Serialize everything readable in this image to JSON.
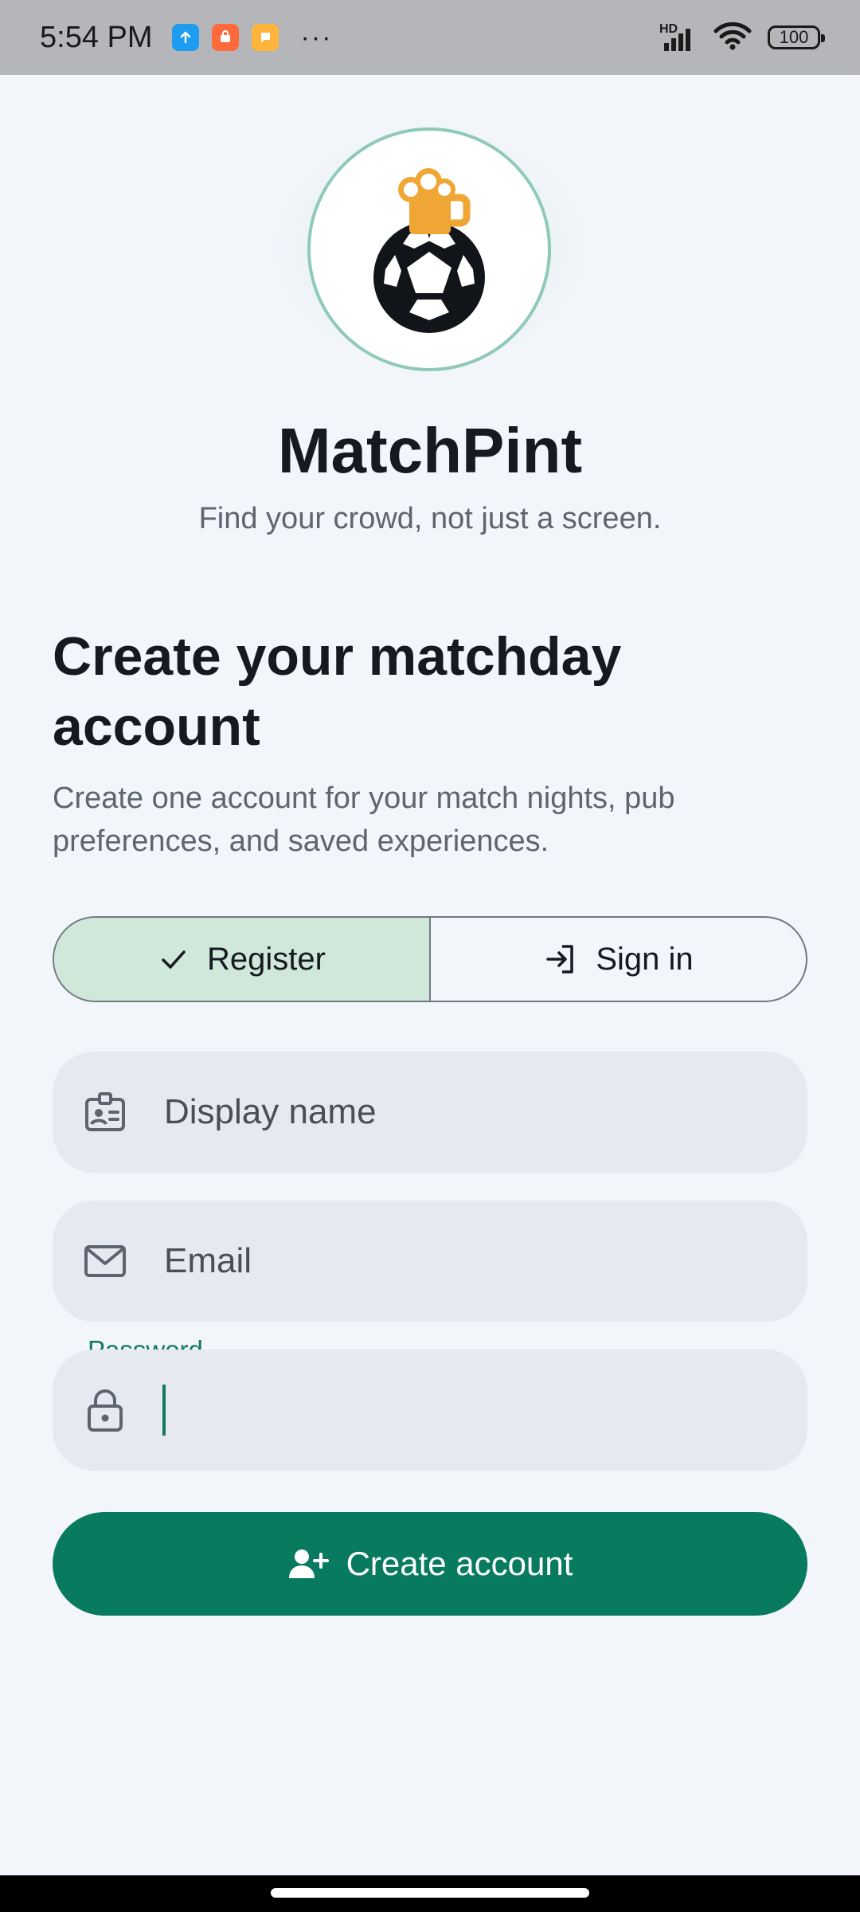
{
  "status_bar": {
    "time": "5:54 PM",
    "dots": "···",
    "battery": "100",
    "network": "HD",
    "colors": {
      "notif1": "#1e9df0",
      "notif2": "#ff6a3d",
      "notif3": "#ffb43c"
    }
  },
  "app": {
    "name": "MatchPint",
    "tagline": "Find your crowd, not just a screen.",
    "logo_icon": "soccer-ball-beer-icon"
  },
  "form": {
    "heading": "Create your matchday account",
    "subtext": "Create one account for your match nights, pub preferences, and saved experiences.",
    "tabs": [
      {
        "label": "Register",
        "active": true,
        "icon": "check-icon"
      },
      {
        "label": "Sign in",
        "active": false,
        "icon": "login-icon"
      }
    ],
    "display_name": {
      "placeholder": "Display name",
      "value": "",
      "icon": "id-badge-icon"
    },
    "email": {
      "placeholder": "Email",
      "value": "",
      "icon": "mail-icon"
    },
    "password": {
      "label": "Password",
      "value": "",
      "icon": "lock-icon"
    },
    "submit_label": "Create account",
    "submit_icon": "person-add-icon"
  },
  "colors": {
    "primary": "#087a5f",
    "active_tab": "#cfe8da",
    "input_bg": "#e6e9ef",
    "background": "#f2f5fa",
    "accent_label": "#127a5e"
  }
}
